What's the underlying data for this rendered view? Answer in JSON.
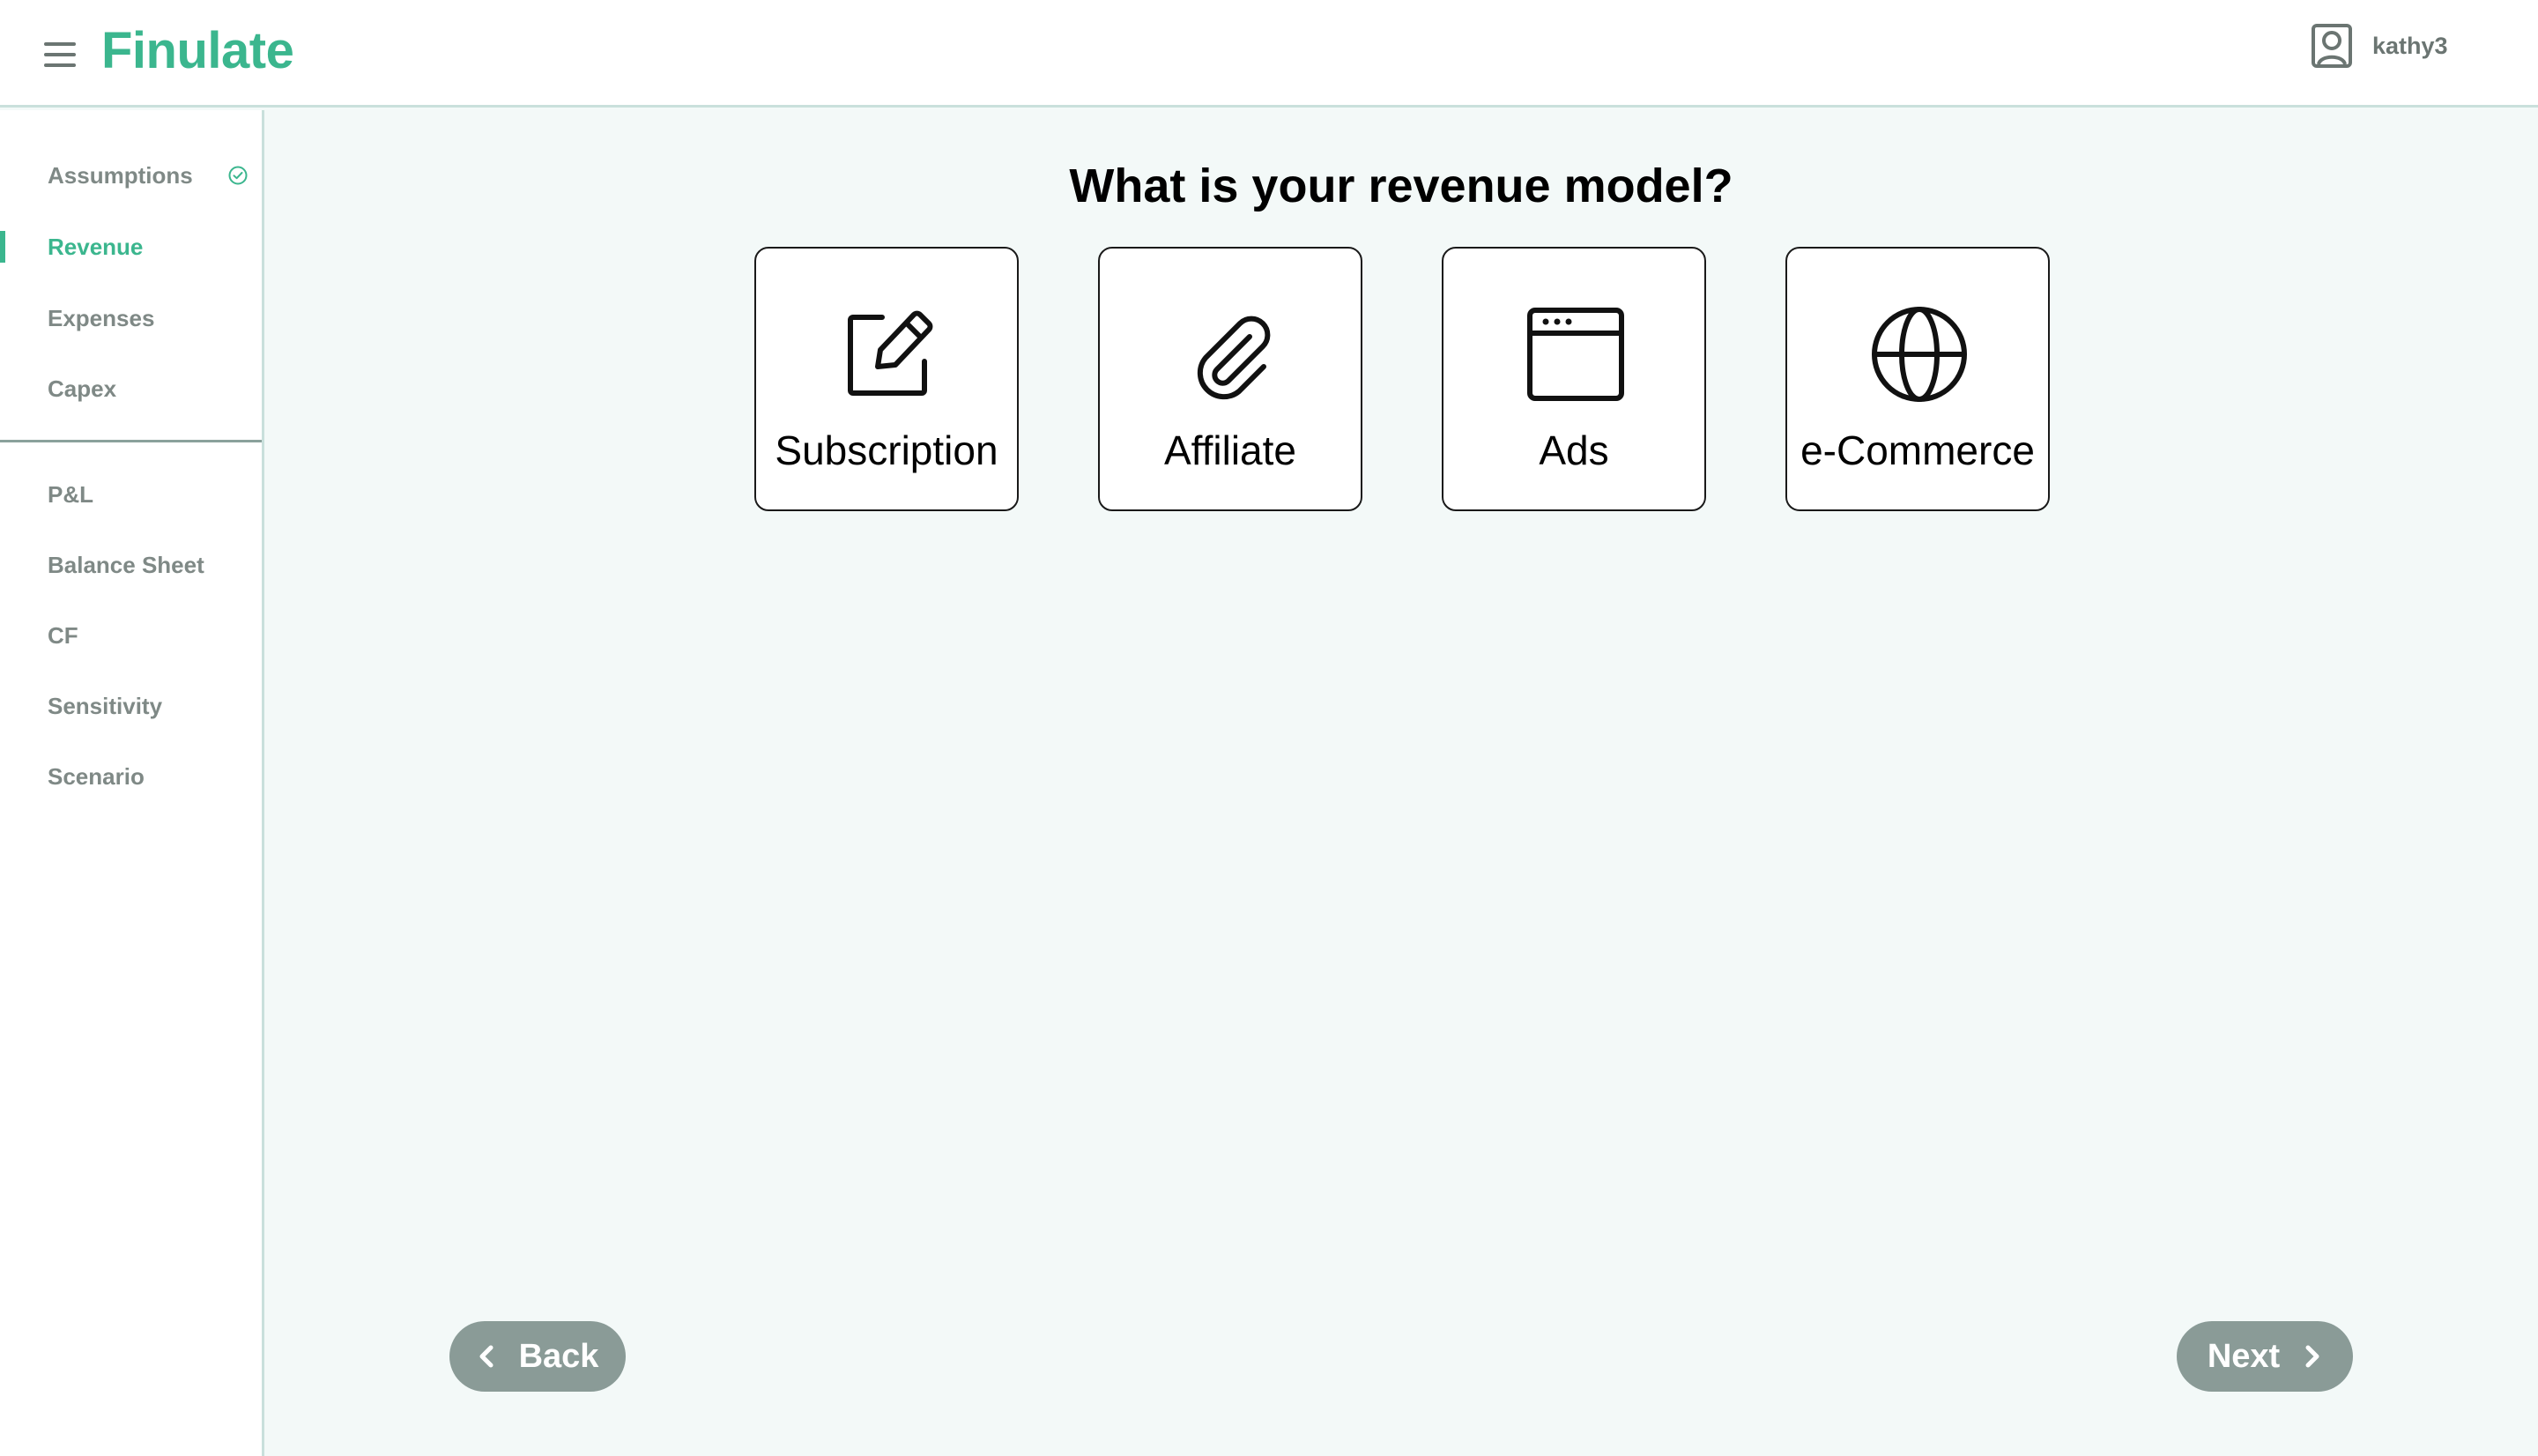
{
  "header": {
    "brand": "Finulate",
    "username": "kathy3",
    "icons": {
      "menu": "hamburger-icon",
      "user": "user-avatar-icon"
    }
  },
  "sidebar": {
    "items": [
      {
        "label": "Assumptions",
        "status": "completed",
        "icon": "check-circle-icon"
      },
      {
        "label": "Revenue",
        "active": true
      },
      {
        "label": "Expenses"
      },
      {
        "label": "Capex"
      },
      {
        "label": "P&L"
      },
      {
        "label": "Balance Sheet"
      },
      {
        "label": "CF"
      },
      {
        "label": "Sensitivity"
      },
      {
        "label": "Scenario"
      }
    ]
  },
  "main": {
    "title": "What is your revenue model?",
    "options": [
      {
        "label": "Subscription",
        "icon": "edit-icon"
      },
      {
        "label": "Affiliate",
        "icon": "paperclip-icon"
      },
      {
        "label": "Ads",
        "icon": "browser-window-icon"
      },
      {
        "label": "e-Commerce",
        "icon": "globe-icon"
      }
    ]
  },
  "footer": {
    "back_label": "Back",
    "next_label": "Next"
  },
  "colors": {
    "brand": "#3bb68e",
    "background": "#f3f9f8",
    "sidebar_text": "#7f8986",
    "button": "#8a9b97",
    "border": "#c9e0dc"
  }
}
